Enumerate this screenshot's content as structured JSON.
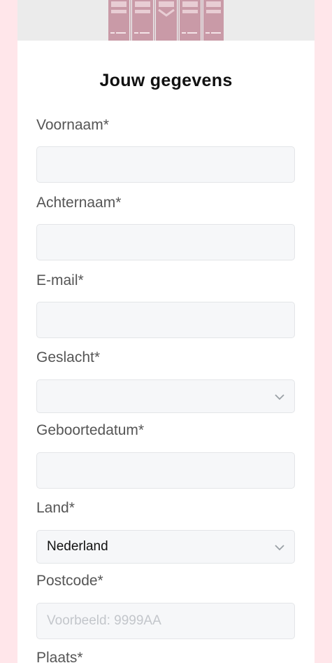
{
  "form": {
    "title": "Jouw gegevens",
    "fields": [
      {
        "label": "Voornaam*",
        "value": "",
        "placeholder": "",
        "type": "text"
      },
      {
        "label": "Achternaam*",
        "value": "",
        "placeholder": "",
        "type": "text"
      },
      {
        "label": "E-mail*",
        "value": "",
        "placeholder": "",
        "type": "email"
      },
      {
        "label": "Geslacht*",
        "value": "",
        "placeholder": "",
        "type": "select"
      },
      {
        "label": "Geboortedatum*",
        "value": "",
        "placeholder": "",
        "type": "text"
      },
      {
        "label": "Land*",
        "value": "Nederland",
        "placeholder": "",
        "type": "select"
      },
      {
        "label": "Postcode*",
        "value": "",
        "placeholder": "Voorbeeld: 9999AA",
        "type": "text"
      },
      {
        "label": "Plaats*",
        "value": "",
        "placeholder": "",
        "type": "text"
      }
    ]
  },
  "colors": {
    "page_background": "#ffe6ea",
    "card_background": "#ffffff",
    "input_background": "#f6f7f9",
    "label_text": "#555555"
  },
  "icons": {
    "dropdown": "chevron-down-icon"
  }
}
